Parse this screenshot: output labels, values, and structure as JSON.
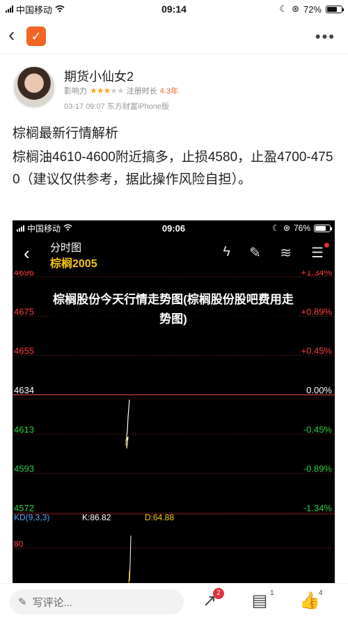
{
  "status": {
    "carrier": "中国移动",
    "time": "09:14",
    "battery": "72%"
  },
  "nav": {
    "back_icon": "back-chevron-icon",
    "logo_icon": "app-logo-icon",
    "more_icon": "more-dots-icon"
  },
  "author": {
    "name": "期货小仙女2",
    "influence_label": "影响力",
    "stars": 3,
    "max_stars": 5,
    "registered_label": "注册时长",
    "registered_value": "4.3年",
    "meta": "03-17 09:07 东方财富iPhone版"
  },
  "post": {
    "title": "棕榈最新行情解析",
    "body": "棕榈油4610-4600附近搞多，止损4580，止盈4700-4750（建议仅供参考，据此操作风险自担）。"
  },
  "embedded": {
    "status_carrier": "中国移动",
    "status_time": "09:06",
    "status_battery": "76%",
    "header_title": "分时图",
    "header_subtitle": "棕榈2005",
    "chart_data": {
      "type": "line",
      "price_levels": [
        4696,
        4675,
        4655,
        4634,
        4613,
        4593,
        4572
      ],
      "pct_levels": [
        "+1.34%",
        "+0.89%",
        "+0.45%",
        "0.00%",
        "-0.45%",
        "-0.89%",
        "-1.34%"
      ],
      "kd_label": "KD(9,3,3)",
      "k_label": "K:86.82",
      "d_label": "D:64.88",
      "kd_level": "80"
    }
  },
  "banner": {
    "text": "棕榈股份今天行情走势图(棕榈股份股吧费用走势图)"
  },
  "bottom": {
    "comment_placeholder": "写评论...",
    "share_count": "2",
    "comment_count": "1",
    "like_count": "4"
  },
  "colors": {
    "accent": "#f26522",
    "up": "#ff3b3b",
    "down": "#2ecc40",
    "gold": "#f5c518"
  }
}
